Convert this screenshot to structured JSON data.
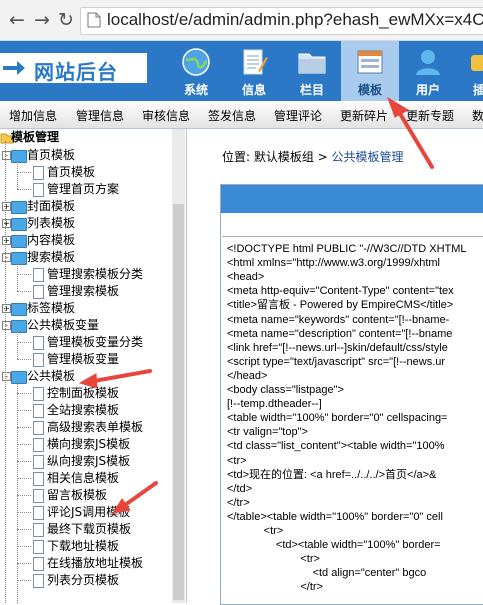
{
  "browser": {
    "url": "localhost/e/admin/admin.php?ehash_ewMXx=x4C"
  },
  "header": {
    "brand": "网站后台",
    "nav": [
      {
        "label": "系统",
        "icon": "globe-icon"
      },
      {
        "label": "信息",
        "icon": "notepad-icon"
      },
      {
        "label": "栏目",
        "icon": "folder-icon"
      },
      {
        "label": "模板",
        "icon": "template-icon",
        "active": true
      },
      {
        "label": "用户",
        "icon": "user-icon"
      },
      {
        "label": "插",
        "icon": "plugin-icon"
      }
    ]
  },
  "menu": [
    "增加信息",
    "管理信息",
    "审核信息",
    "签发信息",
    "管理评论",
    "更新碎片",
    "更新专题",
    "数"
  ],
  "tree": {
    "root": "模板管理",
    "items": [
      {
        "label": "首页模板",
        "level": 0,
        "type": "folder",
        "exp": "-"
      },
      {
        "label": "首页模板",
        "level": 1,
        "type": "doc"
      },
      {
        "label": "管理首页方案",
        "level": 1,
        "type": "doc"
      },
      {
        "label": "封面模板",
        "level": 0,
        "type": "folder",
        "exp": "+"
      },
      {
        "label": "列表模板",
        "level": 0,
        "type": "folder",
        "exp": "+"
      },
      {
        "label": "内容模板",
        "level": 0,
        "type": "folder",
        "exp": "+"
      },
      {
        "label": "搜索模板",
        "level": 0,
        "type": "folder",
        "exp": "-"
      },
      {
        "label": "管理搜索模板分类",
        "level": 1,
        "type": "doc"
      },
      {
        "label": "管理搜索模板",
        "level": 1,
        "type": "doc"
      },
      {
        "label": "标签模板",
        "level": 0,
        "type": "folder",
        "exp": "+"
      },
      {
        "label": "公共模板变量",
        "level": 0,
        "type": "folder",
        "exp": "-"
      },
      {
        "label": "管理模板变量分类",
        "level": 1,
        "type": "doc"
      },
      {
        "label": "管理模板变量",
        "level": 1,
        "type": "doc"
      },
      {
        "label": "公共模板",
        "level": 0,
        "type": "folder",
        "exp": "-"
      },
      {
        "label": "控制面板模板",
        "level": 1,
        "type": "doc"
      },
      {
        "label": "全站搜索模板",
        "level": 1,
        "type": "doc"
      },
      {
        "label": "高级搜索表单模板",
        "level": 1,
        "type": "doc"
      },
      {
        "label": "横向搜索JS模板",
        "level": 1,
        "type": "doc"
      },
      {
        "label": "纵向搜索JS模板",
        "level": 1,
        "type": "doc"
      },
      {
        "label": "相关信息模板",
        "level": 1,
        "type": "doc"
      },
      {
        "label": "留言板模板",
        "level": 1,
        "type": "doc"
      },
      {
        "label": "评论JS调用模板",
        "level": 1,
        "type": "doc"
      },
      {
        "label": "最终下载页模板",
        "level": 1,
        "type": "doc"
      },
      {
        "label": "下载地址模板",
        "level": 1,
        "type": "doc"
      },
      {
        "label": "在线播放地址模板",
        "level": 1,
        "type": "doc"
      },
      {
        "label": "列表分页模板",
        "level": 1,
        "type": "doc"
      }
    ]
  },
  "crumb": {
    "prefix": "位置: 默认模板组 > ",
    "link": "公共模板管理"
  },
  "code": [
    "<!DOCTYPE html PUBLIC \"-//W3C//DTD XHTML",
    "<html xmlns=\"http://www.w3.org/1999/xhtml",
    "<head>",
    "<meta http-equiv=\"Content-Type\" content=\"tex",
    "<title>留言板 - Powered by EmpireCMS</title>",
    "<meta name=\"keywords\" content=\"[!--bname-",
    "<meta name=\"description\" content=\"[!--bname",
    "<link href=\"[!--news.url--]skin/default/css/style",
    "<script type=\"text/javascript\" src=\"[!--news.ur",
    "</head>",
    "<body class=\"listpage\">",
    "[!--temp.dtheader--]",
    "<table width=\"100%\" border=\"0\" cellspacing=",
    "<tr valign=\"top\">",
    "<td class=\"list_content\"><table width=\"100%",
    "<tr>",
    "<td>现在的位置: <a href=../../../>首页</a>&",
    "</td>",
    "</tr>",
    "</table><table width=\"100%\" border=\"0\" cell",
    "            <tr>",
    "                <td><table width=\"100%\" border=",
    "                        <tr>",
    "                            <td align=\"center\" bgco",
    "                        </tr>"
  ]
}
